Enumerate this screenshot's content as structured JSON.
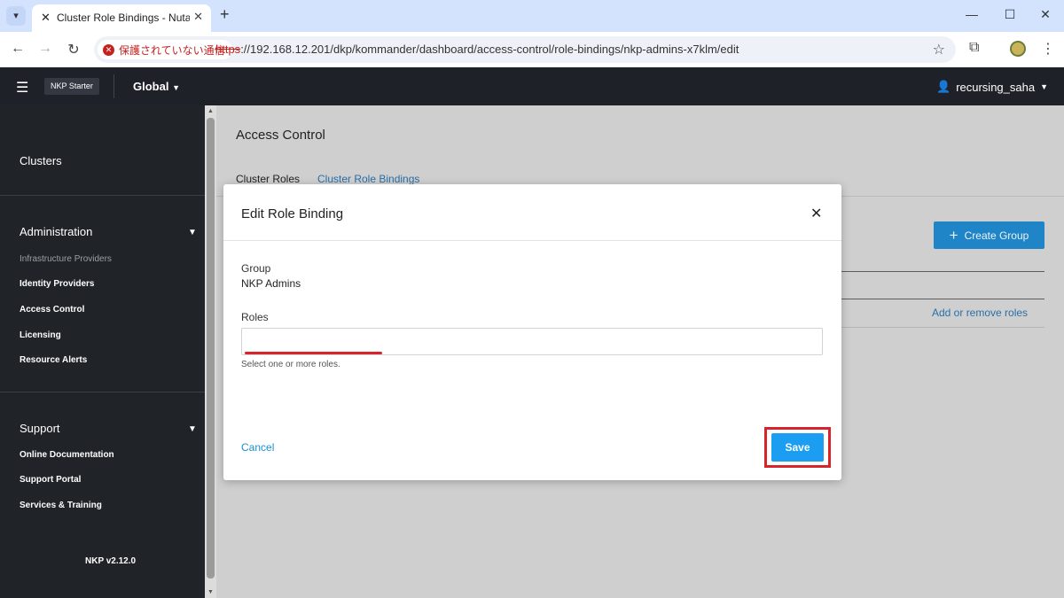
{
  "browser": {
    "tab": {
      "title": "Cluster Role Bindings - Nutanix",
      "close": "✕"
    },
    "new_tab": "+",
    "window_controls": {
      "minimize": "—",
      "maximize": "☐",
      "close": "✕"
    },
    "nav": {
      "back": "←",
      "forward": "→",
      "reload": "↻"
    },
    "security_label": "保護されていない通信",
    "url_scheme": "https",
    "url_rest": "://192.168.12.201/dkp/kommander/dashboard/access-control/role-bindings/nkp-admins-x7klm/edit"
  },
  "header": {
    "brand": "NKP Starter",
    "workspace": "Global",
    "user": "recursing_saha"
  },
  "sidebar": {
    "clusters": "Clusters",
    "administration": {
      "title": "Administration",
      "items": [
        "Infrastructure Providers",
        "Identity Providers",
        "Access Control",
        "Licensing",
        "Resource Alerts"
      ]
    },
    "support": {
      "title": "Support",
      "items": [
        "Online Documentation",
        "Support Portal",
        "Services & Training"
      ]
    },
    "version": "NKP v2.12.0"
  },
  "main": {
    "title": "Access Control",
    "tabs": [
      "Cluster Roles",
      "Cluster Role Bindings"
    ],
    "create_button": "Create Group",
    "add_roles_link": "Add or remove roles"
  },
  "modal": {
    "title": "Edit Role Binding",
    "group_label": "Group",
    "group_value": "NKP Admins",
    "roles_label": "Roles",
    "roles_value": "",
    "roles_helper": "Select one or more roles.",
    "cancel": "Cancel",
    "save": "Save"
  },
  "colors": {
    "accent": "#1b9ef1",
    "highlight": "#d8232a",
    "header_bg": "#1e2127"
  }
}
